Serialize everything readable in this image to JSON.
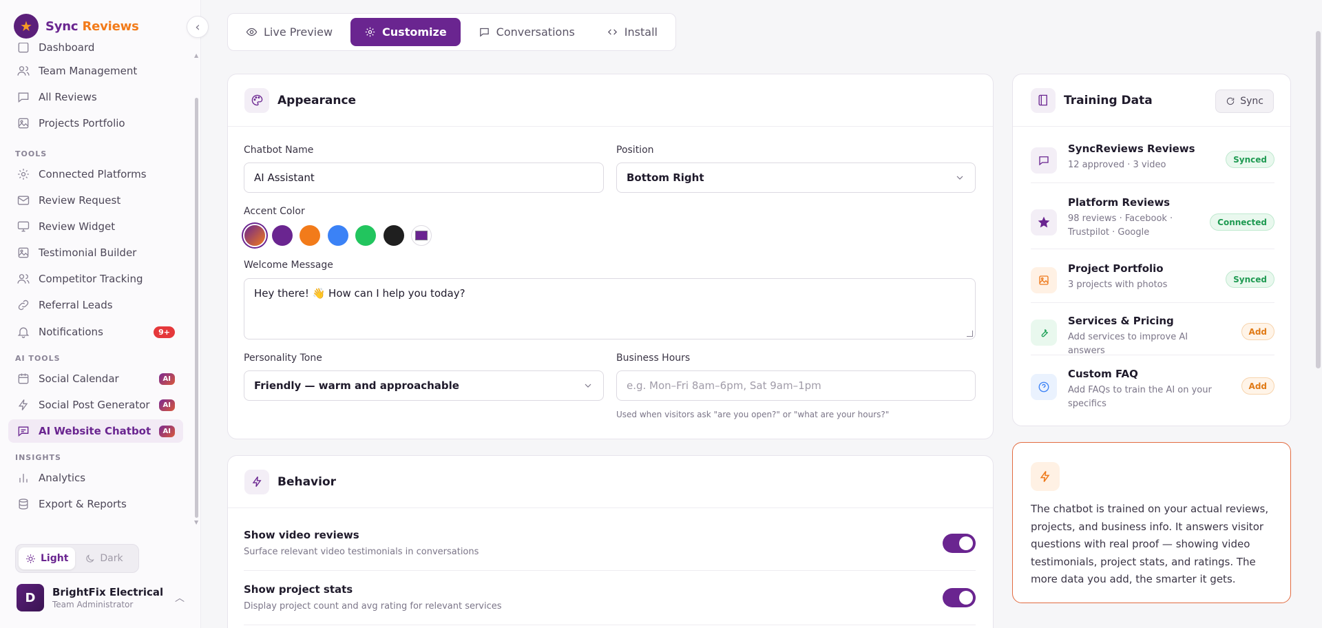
{
  "brand": {
    "name_part1": "Sync",
    "name_part2": "Reviews"
  },
  "sidebar": {
    "partial_item": "Dashboard",
    "items_top": [
      {
        "label": "Team Management"
      },
      {
        "label": "All Reviews"
      },
      {
        "label": "Projects Portfolio"
      }
    ],
    "section_tools": "TOOLS",
    "items_tools": [
      {
        "label": "Connected Platforms"
      },
      {
        "label": "Review Request"
      },
      {
        "label": "Review Widget"
      },
      {
        "label": "Testimonial Builder"
      },
      {
        "label": "Competitor Tracking"
      },
      {
        "label": "Referral Leads"
      },
      {
        "label": "Notifications",
        "badge": "9+"
      }
    ],
    "section_ai": "AI TOOLS",
    "items_ai": [
      {
        "label": "Social Calendar",
        "badge": "AI"
      },
      {
        "label": "Social Post Generator",
        "badge": "AI"
      },
      {
        "label": "AI Website Chatbot",
        "badge": "AI"
      }
    ],
    "section_insights": "INSIGHTS",
    "items_insights": [
      {
        "label": "Analytics"
      },
      {
        "label": "Export & Reports"
      }
    ],
    "theme": {
      "light": "Light",
      "dark": "Dark"
    },
    "user": {
      "name": "BrightFix Electrical",
      "role": "Team Administrator",
      "initial": "D"
    }
  },
  "tabs": [
    {
      "label": "Live Preview"
    },
    {
      "label": "Customize"
    },
    {
      "label": "Conversations"
    },
    {
      "label": "Install"
    }
  ],
  "appearance": {
    "title": "Appearance",
    "chatbot_name_label": "Chatbot Name",
    "chatbot_name_value": "AI Assistant",
    "position_label": "Position",
    "position_value": "Bottom Right",
    "accent_label": "Accent Color",
    "accent_colors": [
      "#6a2590",
      "#f27b1a",
      "#3b82f6",
      "#22c55e",
      "#1f1f1f"
    ],
    "custom_color": "#6a2590",
    "welcome_label": "Welcome Message",
    "welcome_value": "Hey there! 👋 How can I help you today?",
    "tone_label": "Personality Tone",
    "tone_value": "Friendly — warm and approachable",
    "hours_label": "Business Hours",
    "hours_placeholder": "e.g. Mon–Fri 8am–6pm, Sat 9am–1pm",
    "hours_hint": "Used when visitors ask \"are you open?\" or \"what are your hours?\""
  },
  "behavior": {
    "title": "Behavior",
    "rows": [
      {
        "title": "Show video reviews",
        "sub": "Surface relevant video testimonials in conversations",
        "on": true
      },
      {
        "title": "Show project stats",
        "sub": "Display project count and avg rating for relevant services",
        "on": true
      }
    ]
  },
  "training": {
    "title": "Training Data",
    "sync_label": "Sync",
    "items": [
      {
        "title": "SyncReviews Reviews",
        "sub": "12 approved · 3 video",
        "status": "Synced"
      },
      {
        "title": "Platform Reviews",
        "sub": "98 reviews · Facebook · Trustpilot · Google",
        "status": "Connected"
      },
      {
        "title": "Project Portfolio",
        "sub": "3 projects with photos",
        "status": "Synced"
      },
      {
        "title": "Services & Pricing",
        "sub": "Add services to improve AI answers",
        "status": "Add"
      },
      {
        "title": "Custom FAQ",
        "sub": "Add FAQs to train the AI on your specifics",
        "status": "Add"
      }
    ]
  },
  "info": {
    "text": "The chatbot is trained on your actual reviews, projects, and business info. It answers visitor questions with real proof — showing video testimonials, project stats, and ratings. The more data you add, the smarter it gets."
  }
}
